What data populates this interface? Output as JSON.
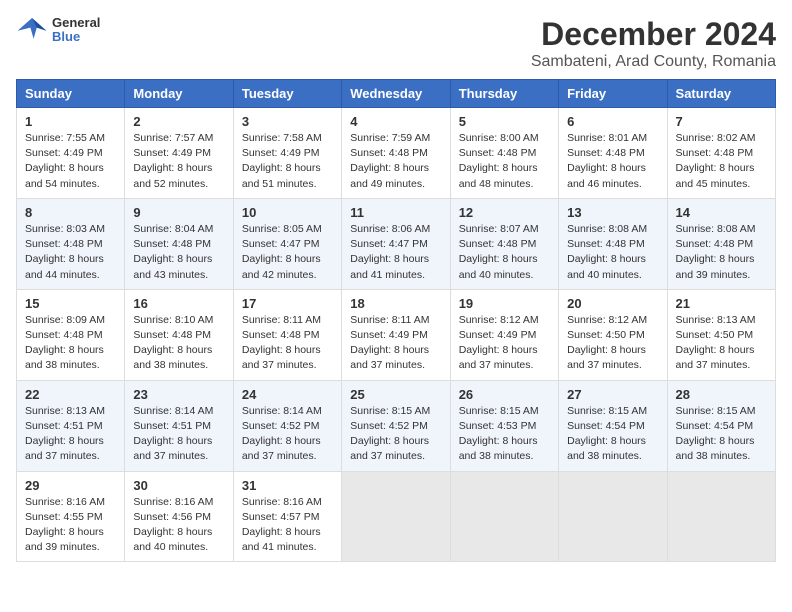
{
  "header": {
    "logo_line1": "General",
    "logo_line2": "Blue",
    "title": "December 2024",
    "subtitle": "Sambateni, Arad County, Romania"
  },
  "weekdays": [
    "Sunday",
    "Monday",
    "Tuesday",
    "Wednesday",
    "Thursday",
    "Friday",
    "Saturday"
  ],
  "weeks": [
    [
      {
        "day": "1",
        "info": "Sunrise: 7:55 AM\nSunset: 4:49 PM\nDaylight: 8 hours\nand 54 minutes."
      },
      {
        "day": "2",
        "info": "Sunrise: 7:57 AM\nSunset: 4:49 PM\nDaylight: 8 hours\nand 52 minutes."
      },
      {
        "day": "3",
        "info": "Sunrise: 7:58 AM\nSunset: 4:49 PM\nDaylight: 8 hours\nand 51 minutes."
      },
      {
        "day": "4",
        "info": "Sunrise: 7:59 AM\nSunset: 4:48 PM\nDaylight: 8 hours\nand 49 minutes."
      },
      {
        "day": "5",
        "info": "Sunrise: 8:00 AM\nSunset: 4:48 PM\nDaylight: 8 hours\nand 48 minutes."
      },
      {
        "day": "6",
        "info": "Sunrise: 8:01 AM\nSunset: 4:48 PM\nDaylight: 8 hours\nand 46 minutes."
      },
      {
        "day": "7",
        "info": "Sunrise: 8:02 AM\nSunset: 4:48 PM\nDaylight: 8 hours\nand 45 minutes."
      }
    ],
    [
      {
        "day": "8",
        "info": "Sunrise: 8:03 AM\nSunset: 4:48 PM\nDaylight: 8 hours\nand 44 minutes."
      },
      {
        "day": "9",
        "info": "Sunrise: 8:04 AM\nSunset: 4:48 PM\nDaylight: 8 hours\nand 43 minutes."
      },
      {
        "day": "10",
        "info": "Sunrise: 8:05 AM\nSunset: 4:47 PM\nDaylight: 8 hours\nand 42 minutes."
      },
      {
        "day": "11",
        "info": "Sunrise: 8:06 AM\nSunset: 4:47 PM\nDaylight: 8 hours\nand 41 minutes."
      },
      {
        "day": "12",
        "info": "Sunrise: 8:07 AM\nSunset: 4:48 PM\nDaylight: 8 hours\nand 40 minutes."
      },
      {
        "day": "13",
        "info": "Sunrise: 8:08 AM\nSunset: 4:48 PM\nDaylight: 8 hours\nand 40 minutes."
      },
      {
        "day": "14",
        "info": "Sunrise: 8:08 AM\nSunset: 4:48 PM\nDaylight: 8 hours\nand 39 minutes."
      }
    ],
    [
      {
        "day": "15",
        "info": "Sunrise: 8:09 AM\nSunset: 4:48 PM\nDaylight: 8 hours\nand 38 minutes."
      },
      {
        "day": "16",
        "info": "Sunrise: 8:10 AM\nSunset: 4:48 PM\nDaylight: 8 hours\nand 38 minutes."
      },
      {
        "day": "17",
        "info": "Sunrise: 8:11 AM\nSunset: 4:48 PM\nDaylight: 8 hours\nand 37 minutes."
      },
      {
        "day": "18",
        "info": "Sunrise: 8:11 AM\nSunset: 4:49 PM\nDaylight: 8 hours\nand 37 minutes."
      },
      {
        "day": "19",
        "info": "Sunrise: 8:12 AM\nSunset: 4:49 PM\nDaylight: 8 hours\nand 37 minutes."
      },
      {
        "day": "20",
        "info": "Sunrise: 8:12 AM\nSunset: 4:50 PM\nDaylight: 8 hours\nand 37 minutes."
      },
      {
        "day": "21",
        "info": "Sunrise: 8:13 AM\nSunset: 4:50 PM\nDaylight: 8 hours\nand 37 minutes."
      }
    ],
    [
      {
        "day": "22",
        "info": "Sunrise: 8:13 AM\nSunset: 4:51 PM\nDaylight: 8 hours\nand 37 minutes."
      },
      {
        "day": "23",
        "info": "Sunrise: 8:14 AM\nSunset: 4:51 PM\nDaylight: 8 hours\nand 37 minutes."
      },
      {
        "day": "24",
        "info": "Sunrise: 8:14 AM\nSunset: 4:52 PM\nDaylight: 8 hours\nand 37 minutes."
      },
      {
        "day": "25",
        "info": "Sunrise: 8:15 AM\nSunset: 4:52 PM\nDaylight: 8 hours\nand 37 minutes."
      },
      {
        "day": "26",
        "info": "Sunrise: 8:15 AM\nSunset: 4:53 PM\nDaylight: 8 hours\nand 38 minutes."
      },
      {
        "day": "27",
        "info": "Sunrise: 8:15 AM\nSunset: 4:54 PM\nDaylight: 8 hours\nand 38 minutes."
      },
      {
        "day": "28",
        "info": "Sunrise: 8:15 AM\nSunset: 4:54 PM\nDaylight: 8 hours\nand 38 minutes."
      }
    ],
    [
      {
        "day": "29",
        "info": "Sunrise: 8:16 AM\nSunset: 4:55 PM\nDaylight: 8 hours\nand 39 minutes."
      },
      {
        "day": "30",
        "info": "Sunrise: 8:16 AM\nSunset: 4:56 PM\nDaylight: 8 hours\nand 40 minutes."
      },
      {
        "day": "31",
        "info": "Sunrise: 8:16 AM\nSunset: 4:57 PM\nDaylight: 8 hours\nand 41 minutes."
      },
      {
        "day": "",
        "info": ""
      },
      {
        "day": "",
        "info": ""
      },
      {
        "day": "",
        "info": ""
      },
      {
        "day": "",
        "info": ""
      }
    ]
  ]
}
